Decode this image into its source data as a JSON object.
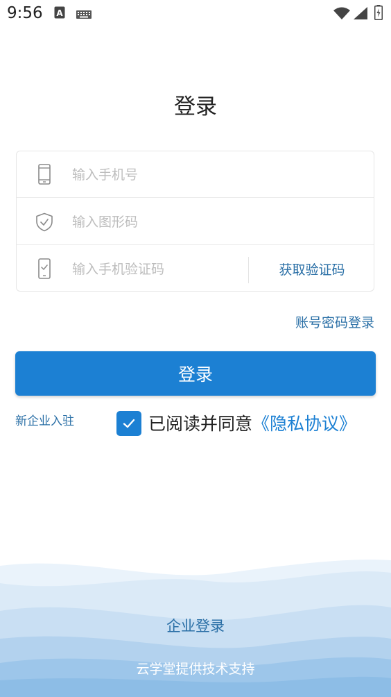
{
  "status_bar": {
    "time": "9:56",
    "icons": [
      "font-a-icon",
      "keyboard-icon",
      "wifi-icon",
      "signal-icon",
      "battery-icon"
    ]
  },
  "page": {
    "title": "登录"
  },
  "form": {
    "phone": {
      "icon": "phone-icon",
      "placeholder": "输入手机号",
      "value": ""
    },
    "captcha": {
      "icon": "shield-check-icon",
      "placeholder": "输入图形码",
      "value": ""
    },
    "sms_code": {
      "icon": "phone-check-icon",
      "placeholder": "输入手机验证码",
      "value": "",
      "get_code_label": "获取验证码"
    }
  },
  "account_login_label": "账号密码登录",
  "login_button_label": "登录",
  "new_enterprise_label": "新企业入驻",
  "agreement": {
    "checked": true,
    "text": "已阅读并同意",
    "link_label": "《隐私协议》"
  },
  "enterprise_login_label": "企业登录",
  "footer_text": "云学堂提供技术支持",
  "colors": {
    "accent": "#1c80d3",
    "link": "#2a6fa6",
    "placeholder": "#bdbdbd",
    "wave_light": "#e7f1fa",
    "wave_dark": "#8dbde6"
  }
}
